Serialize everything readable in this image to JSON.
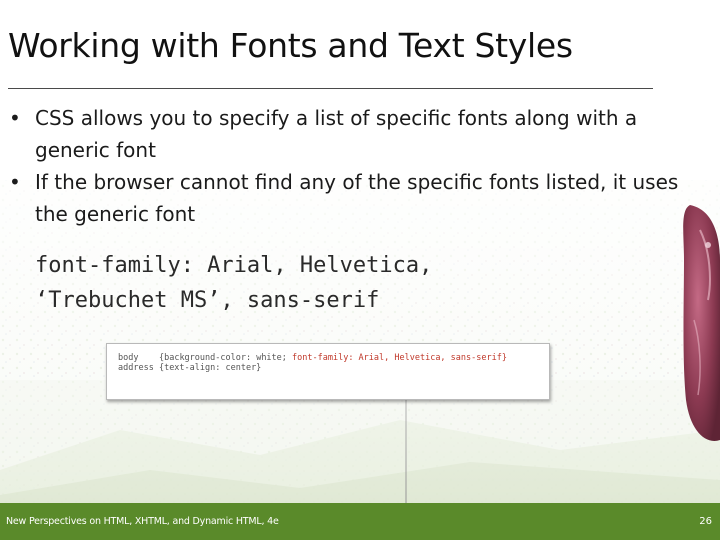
{
  "slide": {
    "title": "Working with Fonts and Text Styles",
    "bullets": [
      "CSS allows you to specify a list of specific fonts along with a generic font",
      "If the browser cannot find any of the specific fonts listed, it uses the generic font"
    ],
    "bullet_symbol": "•",
    "code_lines": [
      "font-family: Arial, Helvetica,",
      "‘Trebuchet MS’, sans-serif"
    ]
  },
  "code_image": {
    "line1": {
      "selector": "body",
      "rule": "{background-color: white;",
      "highlight": "font-family: Arial, Helvetica, sans-serif}"
    },
    "line2": {
      "selector": "address",
      "rule": "{text-align: center}"
    }
  },
  "footer": {
    "text": "New Perspectives on HTML, XHTML, and Dynamic HTML, 4e",
    "slide_number": "26"
  },
  "colors": {
    "footer_bar": "#5a8a2a",
    "flower": "#8c3a52",
    "code_highlight": "#c0392b"
  }
}
